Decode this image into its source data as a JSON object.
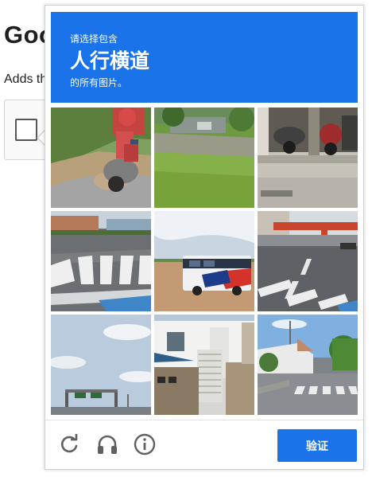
{
  "background_page": {
    "heading_partial": "Goo",
    "text_partial": "Adds th"
  },
  "challenge": {
    "instruction_line1": "请选择包含",
    "target_object": "人行横道",
    "instruction_line3": "的所有图片。",
    "banner_color": "#1a73e8",
    "tiles": [
      {
        "subject": "person riding motorcycle on road"
      },
      {
        "subject": "grass field with road"
      },
      {
        "subject": "parked motorcycles in garage"
      },
      {
        "subject": "crosswalk on street"
      },
      {
        "subject": "bus parked on dirt lot"
      },
      {
        "subject": "crosswalk and road markings"
      },
      {
        "subject": "sky with highway sign gantry"
      },
      {
        "subject": "white house with staircase and fence"
      },
      {
        "subject": "street with crosswalk and houses"
      }
    ]
  },
  "footer": {
    "reload_icon": "reload-icon",
    "audio_icon": "headphones-icon",
    "info_icon": "info-icon",
    "verify_label": "验证"
  }
}
